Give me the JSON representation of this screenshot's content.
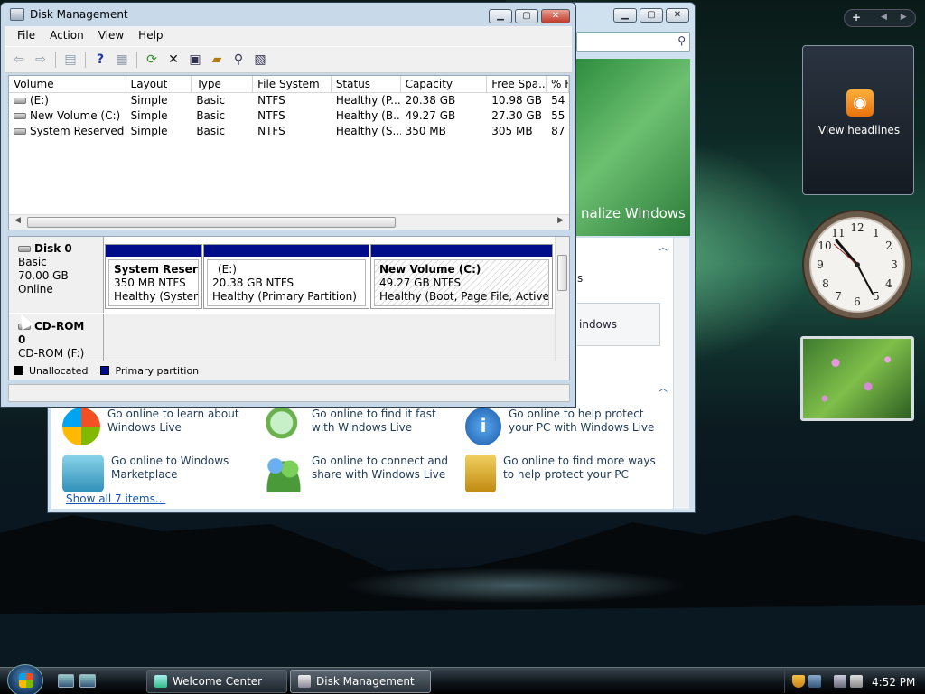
{
  "desktop": {
    "gadgets": {
      "feed_label": "View headlines"
    }
  },
  "welcome_center": {
    "banner_text": "nalize Windows",
    "side_text_1": "s",
    "side_text_2": "indows",
    "items": [
      {
        "text": "Go online to learn about Windows Live",
        "icon": "windows-logo-icon",
        "color": "#3a8fd8"
      },
      {
        "text": "Go online to find it fast with Windows Live",
        "icon": "magnifier-icon",
        "color": "#6ab04c"
      },
      {
        "text": "Go online to help protect your PC with Windows Live",
        "icon": "info-icon",
        "color": "#2a78c8"
      },
      {
        "text": "Go online to Windows Marketplace",
        "icon": "shopping-basket-icon",
        "color": "#4bb0d0"
      },
      {
        "text": "Go online to connect and share with Windows Live",
        "icon": "people-icon",
        "color": "#4a9a3a"
      },
      {
        "text": "Go online to find more ways to help protect your PC",
        "icon": "padlock-icon",
        "color": "#d8a020"
      }
    ],
    "show_all_link": "Show all 7 items..."
  },
  "disk_management": {
    "title": "Disk Management",
    "menu": [
      "File",
      "Action",
      "View",
      "Help"
    ],
    "toolbar_icons": [
      "back-arrow-icon",
      "forward-arrow-icon",
      "up-folder-icon",
      "help-icon",
      "properties-icon",
      "refresh-icon",
      "delete-icon",
      "settings-icon",
      "open-icon",
      "search-icon",
      "export-icon"
    ],
    "columns": [
      "Volume",
      "Layout",
      "Type",
      "File System",
      "Status",
      "Capacity",
      "Free Spa...",
      "% F"
    ],
    "volumes": [
      {
        "volume": "(E:)",
        "layout": "Simple",
        "type": "Basic",
        "fs": "NTFS",
        "status": "Healthy (P...",
        "capacity": "20.38 GB",
        "free": "10.98 GB",
        "pct": "54"
      },
      {
        "volume": "New Volume (C:)",
        "layout": "Simple",
        "type": "Basic",
        "fs": "NTFS",
        "status": "Healthy (B...",
        "capacity": "49.27 GB",
        "free": "27.30 GB",
        "pct": "55"
      },
      {
        "volume": "System Reserved (...",
        "layout": "Simple",
        "type": "Basic",
        "fs": "NTFS",
        "status": "Healthy (S...",
        "capacity": "350 MB",
        "free": "305 MB",
        "pct": "87"
      }
    ],
    "disk0": {
      "name": "Disk 0",
      "type": "Basic",
      "size": "70.00 GB",
      "state": "Online",
      "partitions": [
        {
          "name": "System Reserve",
          "detail": "350 MB NTFS",
          "status": "Healthy (System,"
        },
        {
          "name": "(E:)",
          "detail": "20.38 GB NTFS",
          "status": "Healthy (Primary Partition)"
        },
        {
          "name": "New Volume  (C:)",
          "detail": "49.27 GB NTFS",
          "status": "Healthy (Boot, Page File, Active, Cra"
        }
      ]
    },
    "cdrom0": {
      "name": "CD-ROM 0",
      "drive": "CD-ROM (F:)"
    },
    "legend": {
      "unallocated": "Unallocated",
      "primary": "Primary partition",
      "unallocated_color": "#000000",
      "primary_color": "#000d8a"
    }
  },
  "taskbar": {
    "buttons": [
      "Welcome Center",
      "Disk Management"
    ],
    "time": "4:52 PM"
  }
}
